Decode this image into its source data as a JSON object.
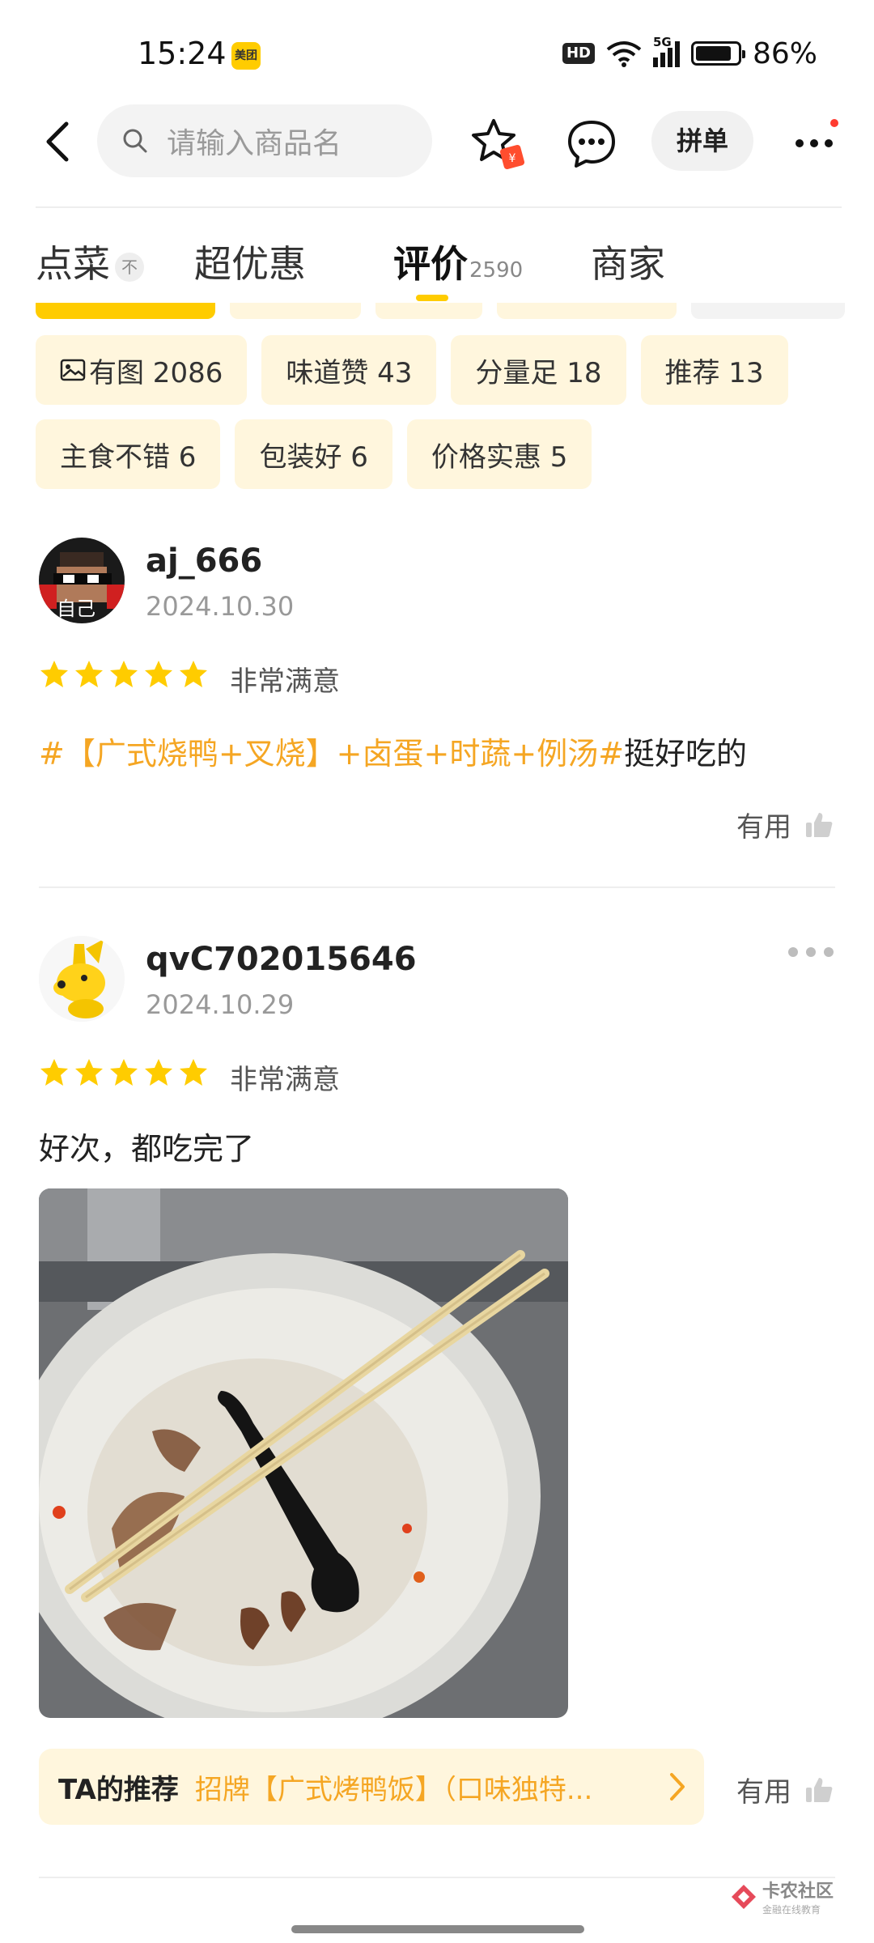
{
  "status_bar": {
    "time": "15:24",
    "app_badge": "美团",
    "network_badge": "HD",
    "signal_label": "5G",
    "battery_percent": "86%",
    "battery_level": 0.86
  },
  "header": {
    "search_placeholder": "请输入商品名",
    "group_order_label": "拼单",
    "icons": [
      "back-arrow-icon",
      "search-icon",
      "favorite-star-icon",
      "chat-icon",
      "more-icon"
    ]
  },
  "tabs": [
    {
      "label": "点菜",
      "pin": "不"
    },
    {
      "label": "超优惠"
    },
    {
      "label": "评价",
      "count": "2590",
      "active": true
    },
    {
      "label": "商家"
    }
  ],
  "tags": {
    "row1": [
      "有图 2086",
      "味道赞 43",
      "分量足 18",
      "推荐 13"
    ],
    "row2": [
      "主食不错 6",
      "包装好 6",
      "价格实惠 5"
    ]
  },
  "reviews": [
    {
      "username": "aj_666",
      "date": "2024.10.30",
      "stars": 5,
      "rating_text": "非常满意",
      "hashtag": "#【广式烧鸭+叉烧】+卤蛋+时蔬+例汤#",
      "text": "挺好吃的",
      "avatar_caption": "自己",
      "useful_label": "有用"
    },
    {
      "username": "qvC702015646",
      "date": "2024.10.29",
      "stars": 5,
      "rating_text": "非常满意",
      "text": "好次，都吃完了",
      "recommend_label": "TA的推荐",
      "recommend_dish": "招牌【广式烤鸭饭】（口味独特...",
      "useful_label": "有用"
    }
  ],
  "watermark": {
    "title": "卡农社区",
    "subtitle": "金融在线教育"
  },
  "colors": {
    "accent": "#ffcc00",
    "hashtag": "#f5a623",
    "star": "#ffcc00",
    "chip_bg": "#fff6dd"
  }
}
